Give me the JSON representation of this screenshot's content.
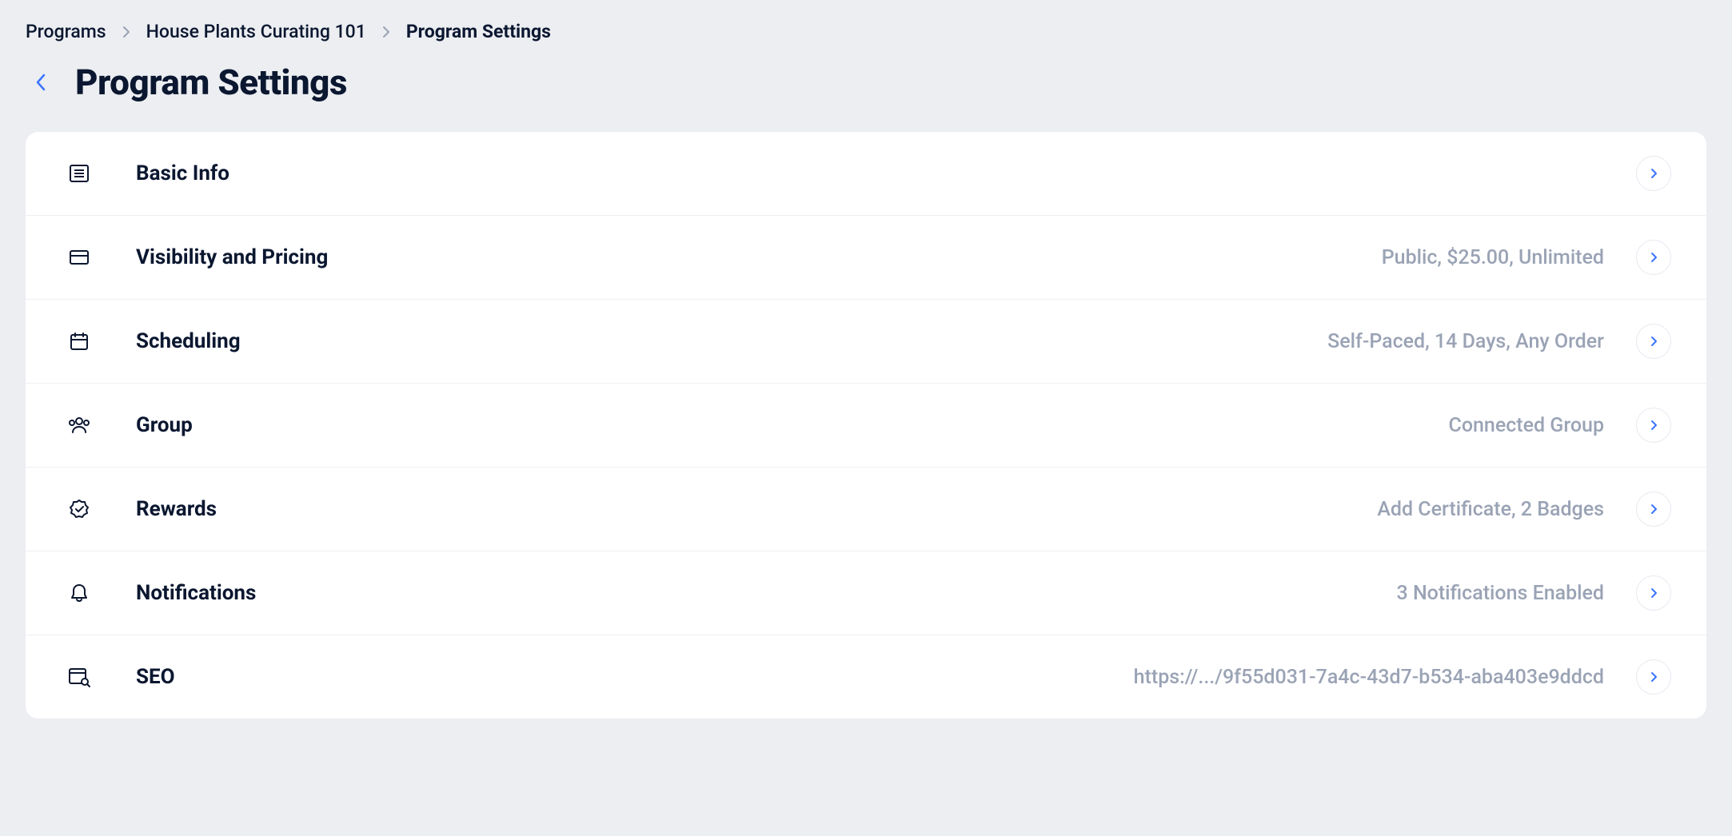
{
  "breadcrumb": {
    "items": [
      {
        "label": "Programs"
      },
      {
        "label": "House Plants Curating 101"
      },
      {
        "label": "Program Settings"
      }
    ]
  },
  "header": {
    "title": "Program Settings"
  },
  "sections": {
    "basic_info": {
      "label": "Basic Info",
      "summary": ""
    },
    "visibility": {
      "label": "Visibility and Pricing",
      "summary": "Public, $25.00, Unlimited"
    },
    "scheduling": {
      "label": "Scheduling",
      "summary": "Self-Paced, 14 Days, Any Order"
    },
    "group": {
      "label": "Group",
      "summary": "Connected Group"
    },
    "rewards": {
      "label": "Rewards",
      "summary": "Add Certificate, 2 Badges"
    },
    "notifications": {
      "label": "Notifications",
      "summary": "3 Notifications Enabled"
    },
    "seo": {
      "label": "SEO",
      "summary": "https://.../9f55d031-7a4c-43d7-b534-aba403e9ddcd"
    }
  }
}
